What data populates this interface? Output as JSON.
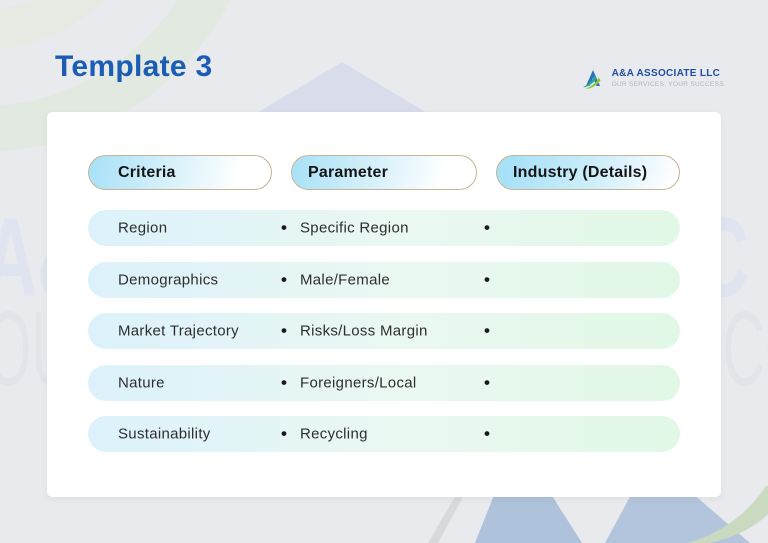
{
  "page": {
    "title": "Template 3"
  },
  "logo": {
    "name": "A&A ASSOCIATE LLC",
    "tagline": "OUR SERVICES. YOUR SUCCESS."
  },
  "watermark": {
    "line1": "A&A ASSOCIATE LLC",
    "line2": "OUR SERVICES. YOUR SUCCESS."
  },
  "table": {
    "bullet": "•",
    "headers": [
      {
        "label": "Criteria"
      },
      {
        "label": "Parameter"
      },
      {
        "label": "Industry (Details)"
      }
    ],
    "rows": [
      {
        "criteria": "Region",
        "parameter": "Specific Region",
        "industry": ""
      },
      {
        "criteria": "Demographics",
        "parameter": "Male/Female",
        "industry": ""
      },
      {
        "criteria": "Market Trajectory",
        "parameter": "Risks/Loss Margin",
        "industry": ""
      },
      {
        "criteria": "Nature",
        "parameter": "Foreigners/Local",
        "industry": ""
      },
      {
        "criteria": "Sustainability",
        "parameter": "Recycling",
        "industry": ""
      }
    ]
  },
  "colors": {
    "title_blue": "#1B5CB5",
    "pill_fill_blue": "#A7E1F7",
    "pill_border_tan": "#C6B593",
    "row_blue": "#DCF1FB",
    "row_green": "#E2F8E6",
    "background_gray": "#E8EAED",
    "watermark_gray": "#E0E4F0",
    "logo_blue": "#1E4F9E",
    "logo_green": "#8CC63F",
    "logo_teal": "#29A8A2"
  }
}
